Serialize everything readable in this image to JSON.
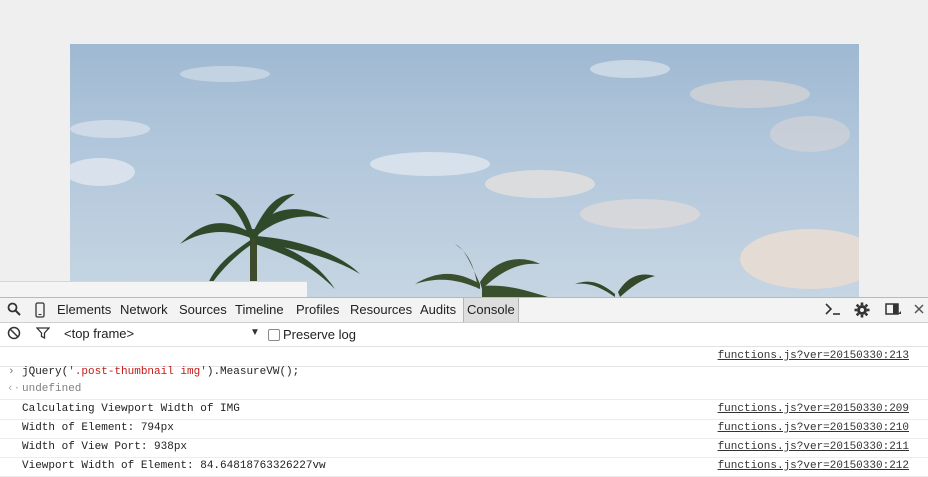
{
  "devtools": {
    "tabs": [
      "Elements",
      "Network",
      "Sources",
      "Timeline",
      "Profiles",
      "Resources",
      "Audits",
      "Console"
    ],
    "active_tab": "Console",
    "frame_select": "<top frame>",
    "preserve_log_label": "Preserve log"
  },
  "console": {
    "first_source": "functions.js?ver=20150330:213",
    "command": {
      "prefix": "jQuery(",
      "string": "'.post-thumbnail img'",
      "suffix": ").MeasureVW();"
    },
    "result": "undefined",
    "logs": [
      {
        "text": "Calculating Viewport Width of IMG",
        "source": "functions.js?ver=20150330:209"
      },
      {
        "text": "Width of Element: 794px",
        "source": "functions.js?ver=20150330:210"
      },
      {
        "text": "Width of View Port: 938px",
        "source": "functions.js?ver=20150330:211"
      },
      {
        "text": "Viewport Width of Element: 84.64818763326227vw",
        "source": "functions.js?ver=20150330:212"
      }
    ]
  }
}
